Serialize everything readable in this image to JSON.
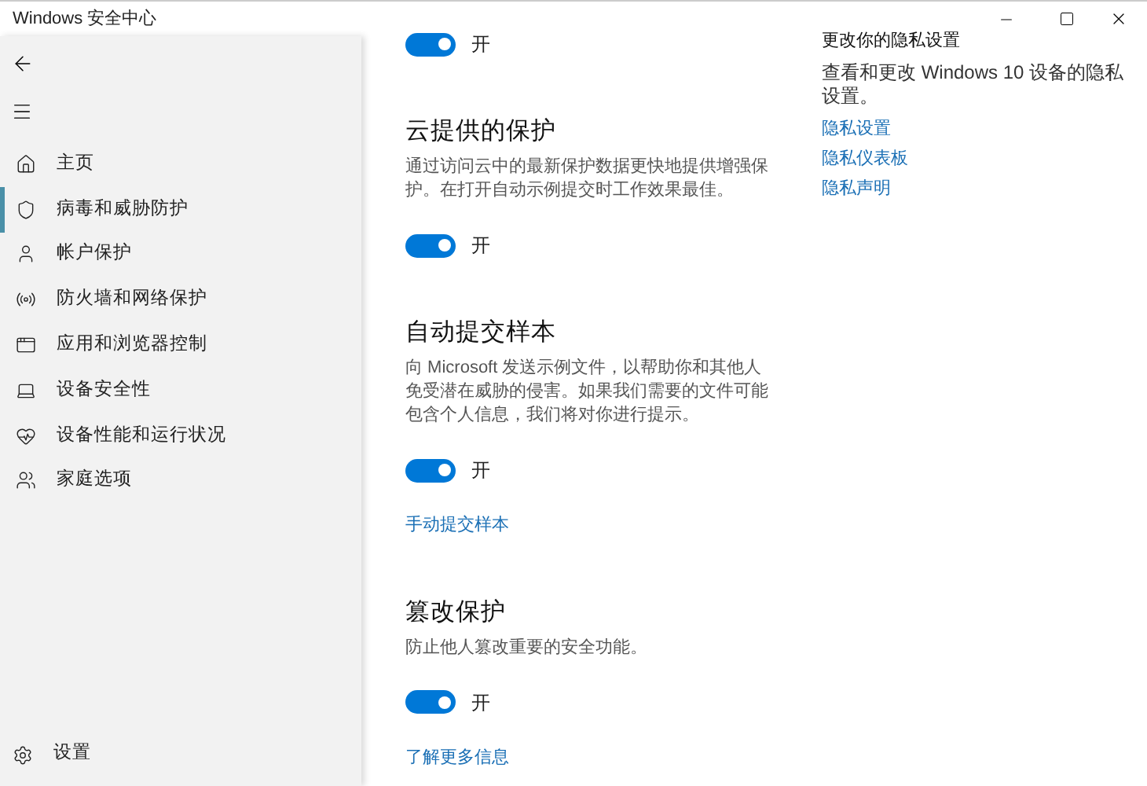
{
  "window": {
    "title": "Windows 安全中心"
  },
  "sidebar": {
    "items": [
      {
        "label": "主页",
        "selected": false
      },
      {
        "label": "病毒和威胁防护",
        "selected": true
      },
      {
        "label": "帐户保护",
        "selected": false
      },
      {
        "label": "防火墙和网络保护",
        "selected": false
      },
      {
        "label": "应用和浏览器控制",
        "selected": false
      },
      {
        "label": "设备安全性",
        "selected": false
      },
      {
        "label": "设备性能和运行状况",
        "selected": false
      },
      {
        "label": "家庭选项",
        "selected": false
      }
    ],
    "settings": {
      "label": "设置"
    }
  },
  "sections": [
    {
      "toggle": {
        "on": true,
        "label": "开"
      }
    },
    {
      "heading": "云提供的保护",
      "description": "通过访问云中的最新保护数据更快地提供增强保护。在打开自动示例提交时工作效果最佳。",
      "toggle": {
        "on": true,
        "label": "开"
      }
    },
    {
      "heading": "自动提交样本",
      "description": "向 Microsoft 发送示例文件，以帮助你和其他人免受潜在威胁的侵害。如果我们需要的文件可能包含个人信息，我们将对你进行提示。",
      "toggle": {
        "on": true,
        "label": "开"
      },
      "link": "手动提交样本"
    },
    {
      "heading": "篡改保护",
      "description": "防止他人篡改重要的安全功能。",
      "toggle": {
        "on": true,
        "label": "开"
      },
      "link": "了解更多信息"
    }
  ],
  "privacy": {
    "heading": "更改你的隐私设置",
    "description": "查看和更改 Windows 10 设备的隐私设置。",
    "links": [
      "隐私设置",
      "隐私仪表板",
      "隐私声明"
    ]
  }
}
